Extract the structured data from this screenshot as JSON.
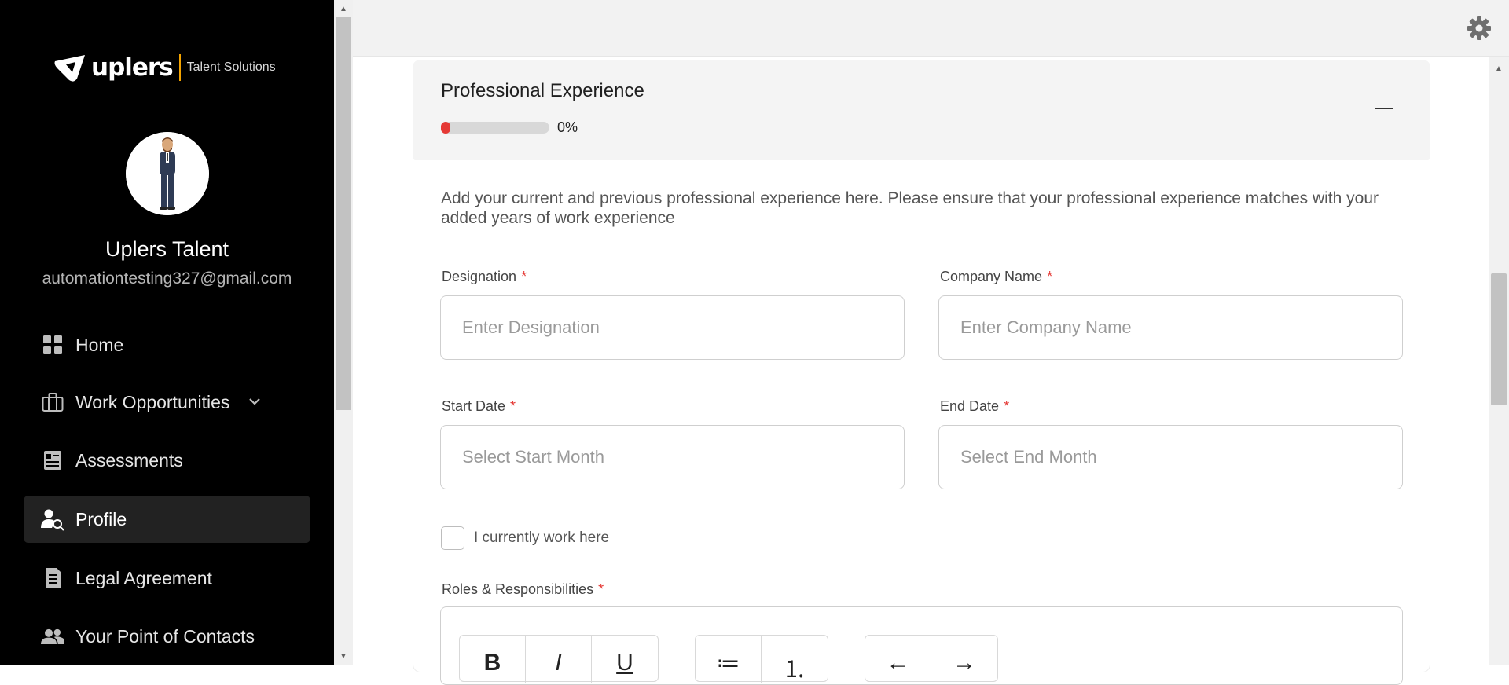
{
  "brand": {
    "wordmark": "uplers",
    "subtitle": "Talent Solutions",
    "accent_color": "#f4a400"
  },
  "user": {
    "name": "Uplers Talent",
    "email": "automationtesting327@gmail.com"
  },
  "nav": {
    "items": [
      {
        "label": "Home",
        "icon": "grid-icon"
      },
      {
        "label": "Work Opportunities",
        "icon": "briefcase-icon",
        "has_dropdown": true
      },
      {
        "label": "Assessments",
        "icon": "assessment-icon"
      },
      {
        "label": "Profile",
        "icon": "profile-search-icon",
        "active": true
      },
      {
        "label": "Legal Agreement",
        "icon": "document-icon"
      },
      {
        "label": "Your Point of Contacts",
        "icon": "contacts-icon"
      }
    ]
  },
  "section": {
    "title": "Professional Experience",
    "progress_text": "0%",
    "progress_value": 0,
    "progress_color": "#e53935",
    "description": "Add your current and previous professional experience here. Please ensure that your professional experience matches with your added years of work experience"
  },
  "form": {
    "designation": {
      "label": "Designation",
      "placeholder": "Enter Designation",
      "required_mark": "*"
    },
    "company": {
      "label": "Company Name",
      "placeholder": "Enter Company Name",
      "required_mark": "*"
    },
    "start_date": {
      "label": "Start Date",
      "placeholder": "Select Start Month",
      "required_mark": "*"
    },
    "end_date": {
      "label": "End Date",
      "placeholder": "Select End Month",
      "required_mark": "*"
    },
    "current_work": {
      "label": "I currently work here",
      "checked": false
    },
    "roles": {
      "label": "Roles & Responsibilities",
      "required_mark": "*"
    }
  },
  "editor_toolbar": {
    "bold": "B",
    "italic": "I",
    "underline": "U",
    "bullet_list": "≔",
    "numbered_list": "⒈",
    "undo": "←",
    "redo": "→"
  }
}
